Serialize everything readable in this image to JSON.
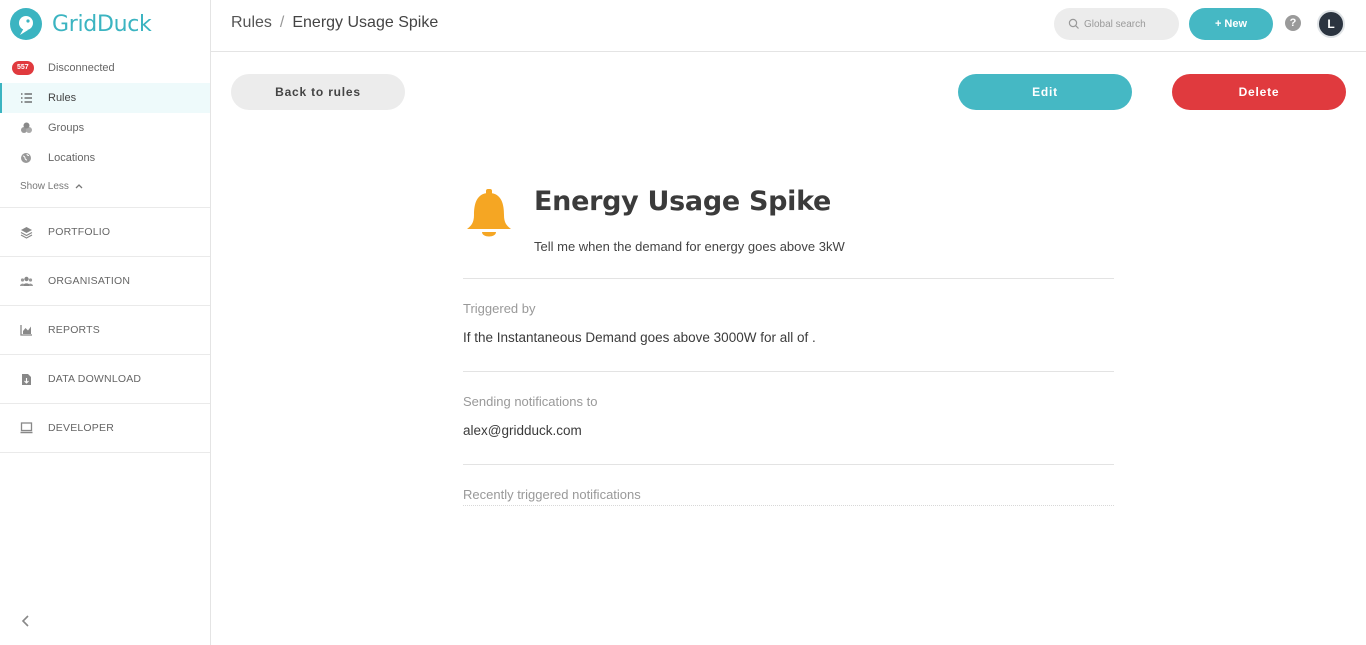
{
  "app": {
    "name": "GridDuck"
  },
  "sidebar": {
    "items": [
      {
        "label": "Disconnected",
        "badge": "557",
        "icon": "alert-badge"
      },
      {
        "label": "Rules",
        "icon": "list-check-icon",
        "active": true
      },
      {
        "label": "Groups",
        "icon": "groups-icon"
      },
      {
        "label": "Locations",
        "icon": "globe-icon"
      }
    ],
    "show_less": "Show Less",
    "sections": [
      {
        "label": "PORTFOLIO",
        "icon": "layers-icon"
      },
      {
        "label": "ORGANISATION",
        "icon": "people-icon"
      },
      {
        "label": "REPORTS",
        "icon": "chart-icon"
      },
      {
        "label": "DATA DOWNLOAD",
        "icon": "download-icon"
      },
      {
        "label": "DEVELOPER",
        "icon": "monitor-icon"
      }
    ]
  },
  "header": {
    "breadcrumb_root": "Rules",
    "breadcrumb_sep": "/",
    "breadcrumb_current": "Energy Usage Spike",
    "search_placeholder": "Global search",
    "new_button": "+ New",
    "help": "?",
    "avatar_initial": "L"
  },
  "actions": {
    "back": "Back to rules",
    "edit": "Edit",
    "delete": "Delete"
  },
  "rule": {
    "title": "Energy Usage Spike",
    "description": "Tell me when the demand for energy goes above 3kW",
    "triggered_by_label": "Triggered by",
    "triggered_by_value": "If the Instantaneous Demand goes above 3000W for all of .",
    "notifications_label": "Sending notifications to",
    "notifications_value": "alex@gridduck.com",
    "recent_label": "Recently triggered notifications"
  },
  "colors": {
    "accent": "#45b8c4",
    "danger": "#e03a3e",
    "bell": "#f5a623"
  }
}
